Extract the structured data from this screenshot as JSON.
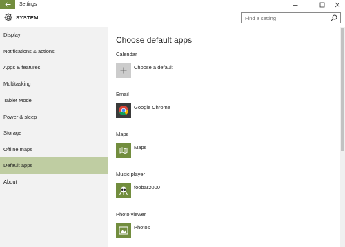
{
  "window": {
    "title": "Settings"
  },
  "header": {
    "section": "SYSTEM",
    "search_placeholder": "Find a setting"
  },
  "sidebar": {
    "items": [
      {
        "label": "Display",
        "active": false
      },
      {
        "label": "Notifications & actions",
        "active": false
      },
      {
        "label": "Apps & features",
        "active": false
      },
      {
        "label": "Multitasking",
        "active": false
      },
      {
        "label": "Tablet Mode",
        "active": false
      },
      {
        "label": "Power & sleep",
        "active": false
      },
      {
        "label": "Storage",
        "active": false
      },
      {
        "label": "Offline maps",
        "active": false
      },
      {
        "label": "Default apps",
        "active": true
      },
      {
        "label": "About",
        "active": false
      }
    ]
  },
  "main": {
    "title": "Choose default apps",
    "sections": [
      {
        "category": "Calendar",
        "app": "Choose a default",
        "icon": "plus-icon"
      },
      {
        "category": "Email",
        "app": "Google Chrome",
        "icon": "chrome-icon"
      },
      {
        "category": "Maps",
        "app": "Maps",
        "icon": "maps-icon"
      },
      {
        "category": "Music player",
        "app": "foobar2000",
        "icon": "foobar-icon"
      },
      {
        "category": "Photo viewer",
        "app": "Photos",
        "icon": "photos-icon"
      }
    ]
  },
  "colors": {
    "accent": "#728d3e",
    "selected_nav": "#bfcda2",
    "sidebar_bg": "#f2f2f2"
  }
}
